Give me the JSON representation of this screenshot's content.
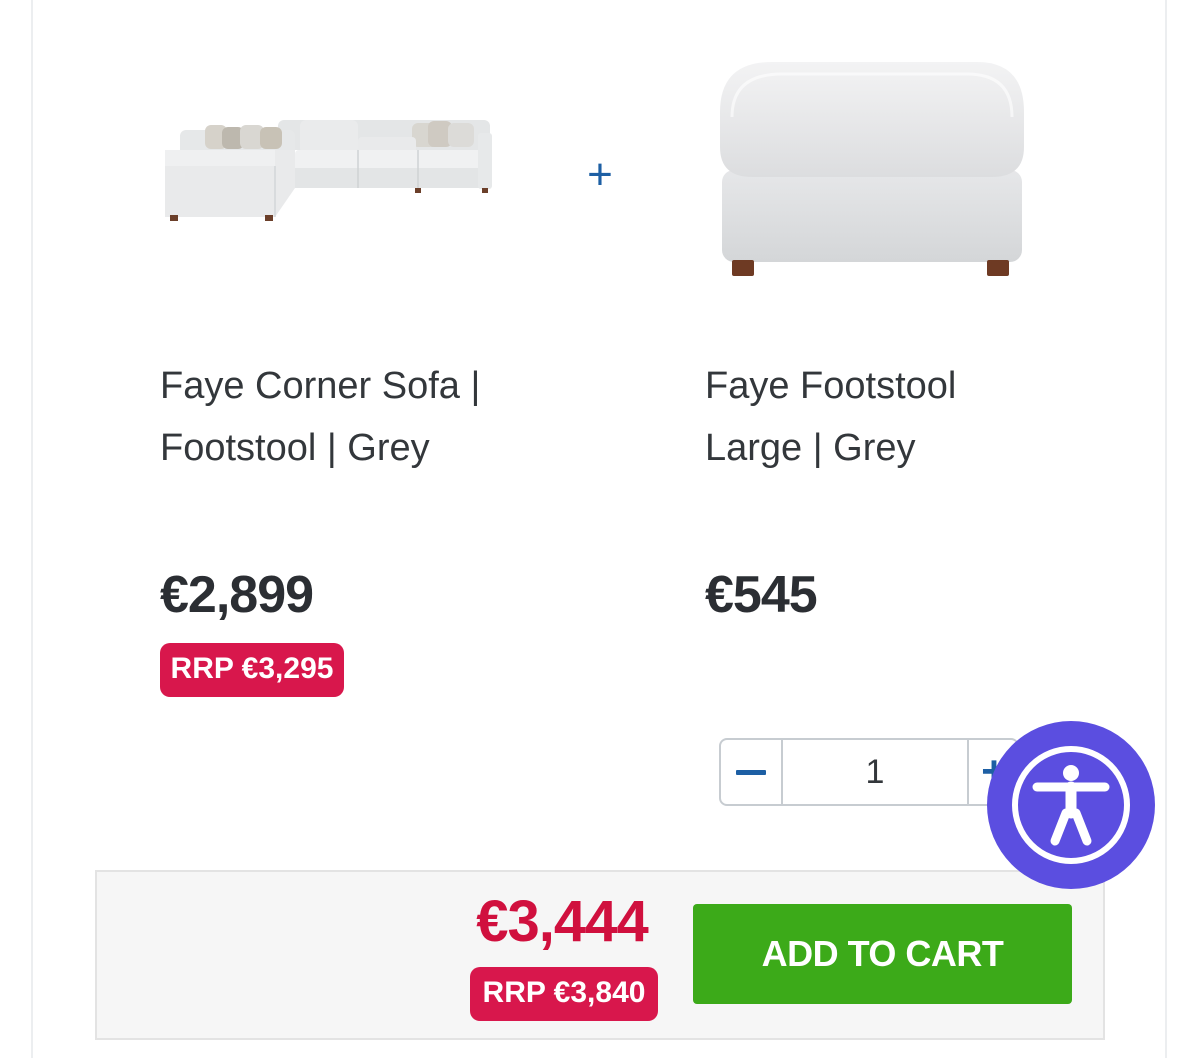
{
  "bundle": {
    "products": [
      {
        "title": "Faye Corner Sofa |\nFootstool | Grey",
        "price": "€2,899",
        "rrp": "RRP €3,295",
        "image": "sofa-image"
      },
      {
        "title": "Faye Footstool\nLarge | Grey",
        "price": "€545",
        "image": "footstool-image"
      }
    ],
    "plus_symbol": "+",
    "quantity": {
      "value": "1",
      "decrement_icon": "minus-icon",
      "increment_icon": "plus-icon"
    },
    "total": {
      "price": "€3,444",
      "rrp": "RRP €3,840"
    },
    "cta": {
      "label": "ADD TO CART"
    }
  },
  "accessibility": {
    "icon": "accessibility-person-icon"
  },
  "colors": {
    "accent_blue": "#1d5fa4",
    "rrp_badge": "#d8174c",
    "total_price": "#d0103e",
    "cart_green": "#3caa19",
    "accessibility_purple": "#5b4ee0"
  }
}
